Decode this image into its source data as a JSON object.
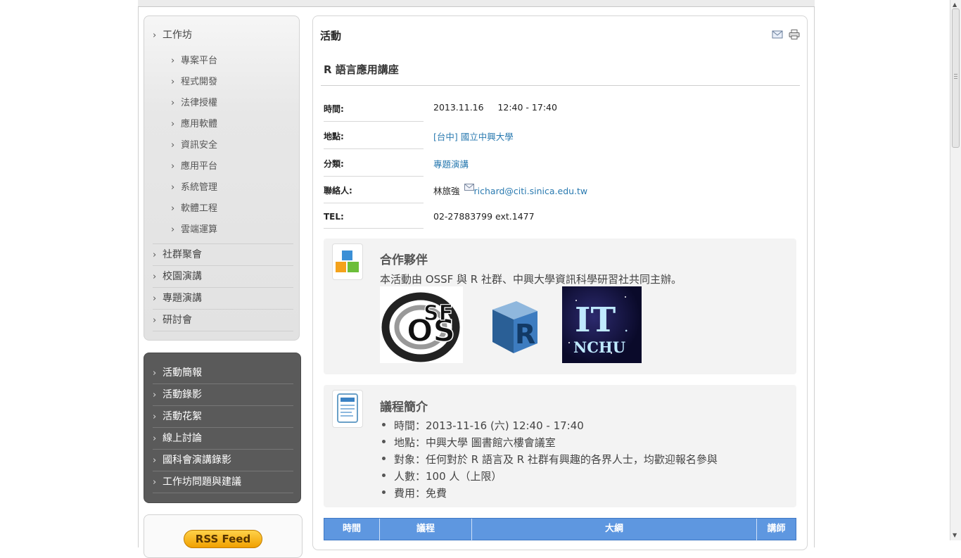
{
  "menu_primary": {
    "items": [
      {
        "label": "工作坊"
      },
      {
        "label": "社群聚會"
      },
      {
        "label": "校園演講"
      },
      {
        "label": "專題演講"
      },
      {
        "label": "研討會"
      }
    ],
    "sub_items": [
      {
        "label": "專案平台"
      },
      {
        "label": "程式開發"
      },
      {
        "label": "法律授權"
      },
      {
        "label": "應用軟體"
      },
      {
        "label": "資訊安全"
      },
      {
        "label": "應用平台"
      },
      {
        "label": "系統管理"
      },
      {
        "label": "軟體工程"
      },
      {
        "label": "雲端運算"
      }
    ]
  },
  "menu_secondary": {
    "items": [
      {
        "label": "活動簡報"
      },
      {
        "label": "活動錄影"
      },
      {
        "label": "活動花絮"
      },
      {
        "label": "線上討論"
      },
      {
        "label": "國科會演講錄影"
      },
      {
        "label": "工作坊問題與建議"
      }
    ]
  },
  "rss": {
    "label": "RSS Feed"
  },
  "content": {
    "section_title": "活動",
    "article_title": "R 語言應用講座",
    "icons": [
      "email-icon",
      "print-icon"
    ],
    "info": {
      "time_label": "時間:",
      "time_value": "2013.11.16     12:40 - 17:40",
      "place_label": "地點:",
      "place_value": "[台中] 國立中興大學",
      "category_label": "分類:",
      "category_value": "專題演講",
      "contact_label": "聯絡人:",
      "contact_name": "林旅強",
      "contact_email": "richard@citi.sinica.edu.tw",
      "tel_label": "TEL:",
      "tel_value": "02-27883799 ext.1477"
    },
    "partners": {
      "heading": "合作夥伴",
      "text": "本活動由 OSSF 與 R 社群、中興大學資訊科學研習社共同主辦。",
      "logos": [
        "OSSF",
        "R",
        "IT. NCHU"
      ]
    },
    "agenda": {
      "heading": "議程簡介",
      "bullets": [
        "時間：2013-11-16 (六) 12:40 - 17:40",
        "地點：中興大學 圖書館六樓會議室",
        "對象：任何對於 R 語言及 R 社群有興趣的各界人士，均歡迎報名參與",
        "人數：100 人（上限）",
        "費用：免費"
      ]
    },
    "schedule_table": {
      "headers": [
        "時間",
        "議程",
        "大綱",
        "講師"
      ]
    }
  },
  "colors": {
    "link": "#2a7ab0",
    "table_header": "#5e97e0",
    "dark_menu": "#5a5a5a"
  }
}
